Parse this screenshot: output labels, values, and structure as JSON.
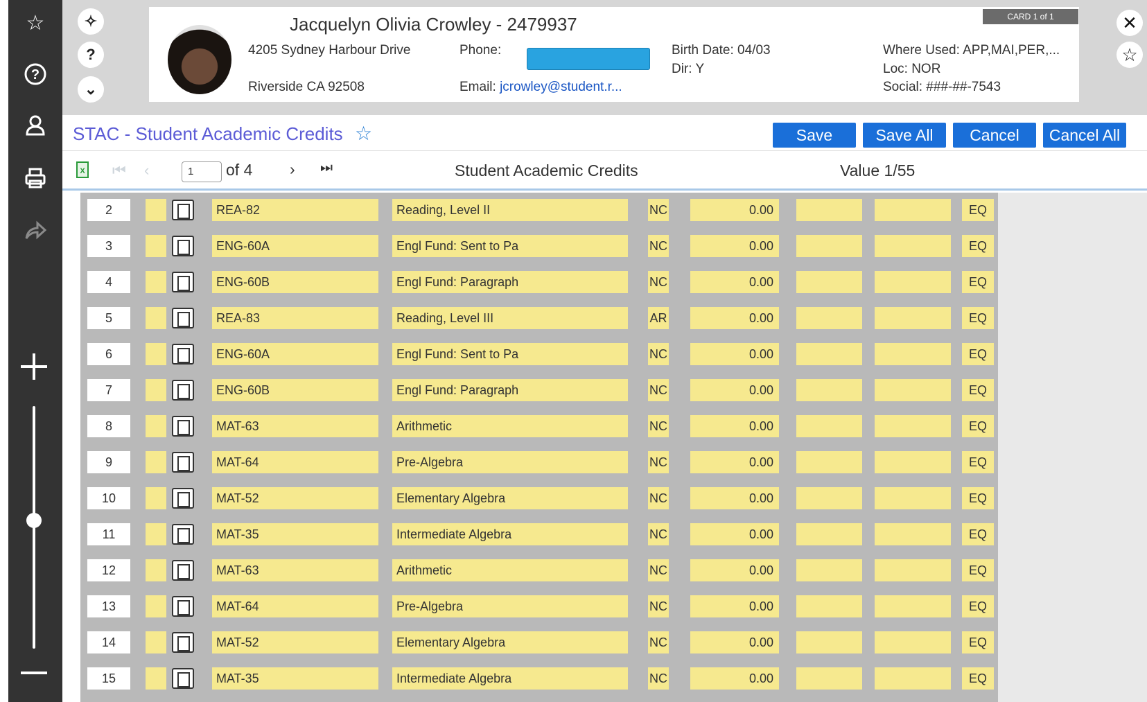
{
  "student": {
    "name_line": "Jacquelyn Olivia Crowley  -  2479937",
    "address1": "4205 Sydney Harbour Drive",
    "address2": "Riverside CA 92508",
    "phone_label": "Phone:",
    "email_label": "Email:",
    "email_value": "jcrowley@student.r...",
    "birth_date": "Birth Date: 04/03",
    "dir": "Dir: Y",
    "where_used": "Where Used: APP,MAI,PER,...",
    "loc": "Loc: NOR",
    "social": "Social: ###-##-7543",
    "card_badge": "CARD 1 of 1"
  },
  "form": {
    "title": "STAC - Student Academic Credits",
    "buttons": {
      "save": "Save",
      "save_all": "Save All",
      "cancel": "Cancel",
      "cancel_all": "Cancel All"
    }
  },
  "toolbar": {
    "page_value": "1",
    "page_of": "of 4",
    "grid_title": "Student Academic Credits",
    "value_counter": "Value 1/55"
  },
  "icons": {
    "left_bar": [
      "star-icon",
      "help-icon",
      "user-icon",
      "print-icon",
      "share-icon",
      "zoom-in-icon",
      "zoom-out-icon"
    ],
    "header": [
      "pin-icon",
      "help-icon",
      "chevron-down-icon",
      "close-icon",
      "favorite-icon"
    ]
  },
  "colors": {
    "field_yellow": "#f6e98f",
    "button_blue": "#1a6fd9",
    "title_purple": "#5b5bd6",
    "left_bar": "#333333"
  },
  "rows": [
    {
      "num": "2",
      "code": "REA-82",
      "title": "Reading, Level II",
      "grade": "NC",
      "credits": "0.00",
      "type": "EQ"
    },
    {
      "num": "3",
      "code": "ENG-60A",
      "title": "Engl Fund: Sent to Pa",
      "grade": "NC",
      "credits": "0.00",
      "type": "EQ"
    },
    {
      "num": "4",
      "code": "ENG-60B",
      "title": "Engl Fund: Paragraph",
      "grade": "NC",
      "credits": "0.00",
      "type": "EQ"
    },
    {
      "num": "5",
      "code": "REA-83",
      "title": "Reading, Level III",
      "grade": "AR",
      "credits": "0.00",
      "type": "EQ"
    },
    {
      "num": "6",
      "code": "ENG-60A",
      "title": "Engl Fund: Sent to Pa",
      "grade": "NC",
      "credits": "0.00",
      "type": "EQ"
    },
    {
      "num": "7",
      "code": "ENG-60B",
      "title": "Engl Fund: Paragraph",
      "grade": "NC",
      "credits": "0.00",
      "type": "EQ"
    },
    {
      "num": "8",
      "code": "MAT-63",
      "title": "Arithmetic",
      "grade": "NC",
      "credits": "0.00",
      "type": "EQ"
    },
    {
      "num": "9",
      "code": "MAT-64",
      "title": "Pre-Algebra",
      "grade": "NC",
      "credits": "0.00",
      "type": "EQ"
    },
    {
      "num": "10",
      "code": "MAT-52",
      "title": "Elementary Algebra",
      "grade": "NC",
      "credits": "0.00",
      "type": "EQ"
    },
    {
      "num": "11",
      "code": "MAT-35",
      "title": "Intermediate Algebra",
      "grade": "NC",
      "credits": "0.00",
      "type": "EQ"
    },
    {
      "num": "12",
      "code": "MAT-63",
      "title": "Arithmetic",
      "grade": "NC",
      "credits": "0.00",
      "type": "EQ"
    },
    {
      "num": "13",
      "code": "MAT-64",
      "title": "Pre-Algebra",
      "grade": "NC",
      "credits": "0.00",
      "type": "EQ"
    },
    {
      "num": "14",
      "code": "MAT-52",
      "title": "Elementary Algebra",
      "grade": "NC",
      "credits": "0.00",
      "type": "EQ"
    },
    {
      "num": "15",
      "code": "MAT-35",
      "title": "Intermediate Algebra",
      "grade": "NC",
      "credits": "0.00",
      "type": "EQ"
    }
  ]
}
